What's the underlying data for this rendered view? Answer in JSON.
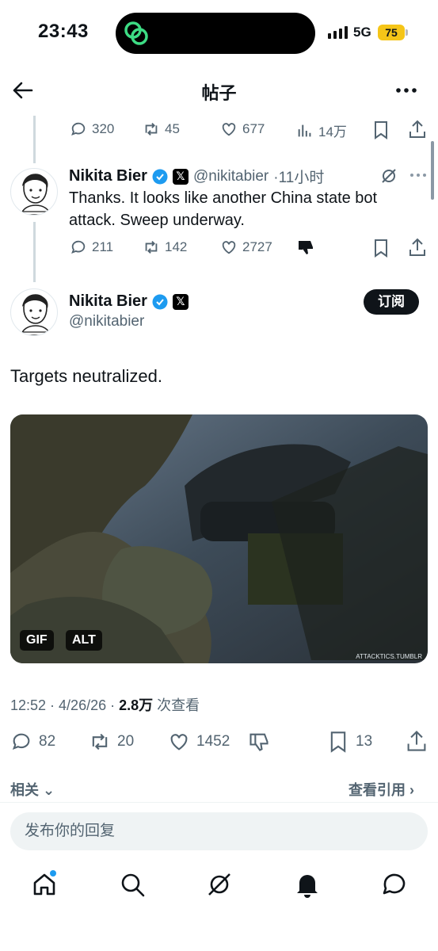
{
  "status": {
    "time": "23:43",
    "network": "5G",
    "battery": "75"
  },
  "header": {
    "title": "帖子"
  },
  "parent_stats": {
    "replies": "320",
    "retweets": "45",
    "likes": "677",
    "views": "14万"
  },
  "reply_tweet": {
    "name": "Nikita Bier",
    "handle": "@nikitabier",
    "time": "·11小时",
    "text": "Thanks. It looks like another China state bot attack. Sweep underway.",
    "replies": "211",
    "retweets": "142",
    "likes": "2727"
  },
  "main_tweet": {
    "name": "Nikita Bier",
    "handle": "@nikitabier",
    "subscribe_label": "订阅",
    "text": "Targets neutralized.",
    "media_badges": {
      "gif": "GIF",
      "alt": "ALT"
    },
    "watermark": "ATTACKTICS.TUMBLR",
    "timestamp": "12:52 · 4/26/26 · ",
    "views_count": "2.8万",
    "views_label": " 次查看",
    "replies": "82",
    "retweets": "20",
    "likes": "1452",
    "bookmarks": "13"
  },
  "related_label": "相关",
  "quotes_label": "查看引用",
  "reply_placeholder": "发布你的回复",
  "colors": {
    "accent": "#1d9bf0",
    "text": "#0f1419",
    "muted": "#536471",
    "battery": "#f5c518",
    "verified": "#1d9bf0",
    "island_logo": "#3ddc84"
  },
  "icons": [
    "back-arrow-icon",
    "more-icon",
    "reply-icon",
    "retweet-icon",
    "like-icon",
    "views-icon",
    "bookmark-icon",
    "share-icon",
    "verified-icon",
    "x-badge-icon",
    "grok-icon",
    "dislike-icon",
    "home-icon",
    "search-icon",
    "notifications-icon",
    "messages-icon"
  ]
}
